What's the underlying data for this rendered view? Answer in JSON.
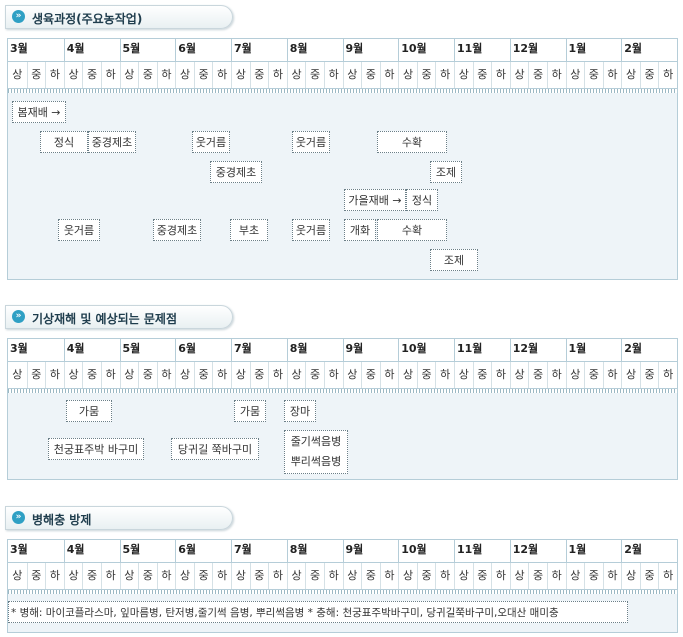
{
  "months": [
    "3월",
    "4월",
    "5월",
    "6월",
    "7월",
    "8월",
    "9월",
    "10월",
    "11월",
    "12월",
    "1월",
    "2월"
  ],
  "subs": [
    "상",
    "중",
    "하"
  ],
  "sections": [
    {
      "title": "생육과정(주요농작업)",
      "items": [
        "봄재배 →",
        "정식",
        "중경제초",
        "웃거름",
        "웃거름",
        "수확",
        "중경제초",
        "조제",
        "가을재배 →",
        "정식",
        "웃거름",
        "중경제초",
        "부초",
        "웃거름",
        "개화",
        "수확",
        "조제"
      ]
    },
    {
      "title": "기상재해 및 예상되는 문제점",
      "items": [
        "가뭄",
        "가뭄",
        "장마",
        "천궁표주박 바구미",
        "당귀길 쭉바구미"
      ],
      "multi": [
        "줄기썩음병",
        "뿌리썩음병"
      ]
    },
    {
      "title": "병해충 방제",
      "items": [
        "* 병해: 마이코플라스마, 잎마름병, 탄저병,줄기썩 음병, 뿌리썩음병 * 충해: 천궁표주박바구미, 당귀길쭉바구미,오대산 매미충"
      ]
    }
  ]
}
